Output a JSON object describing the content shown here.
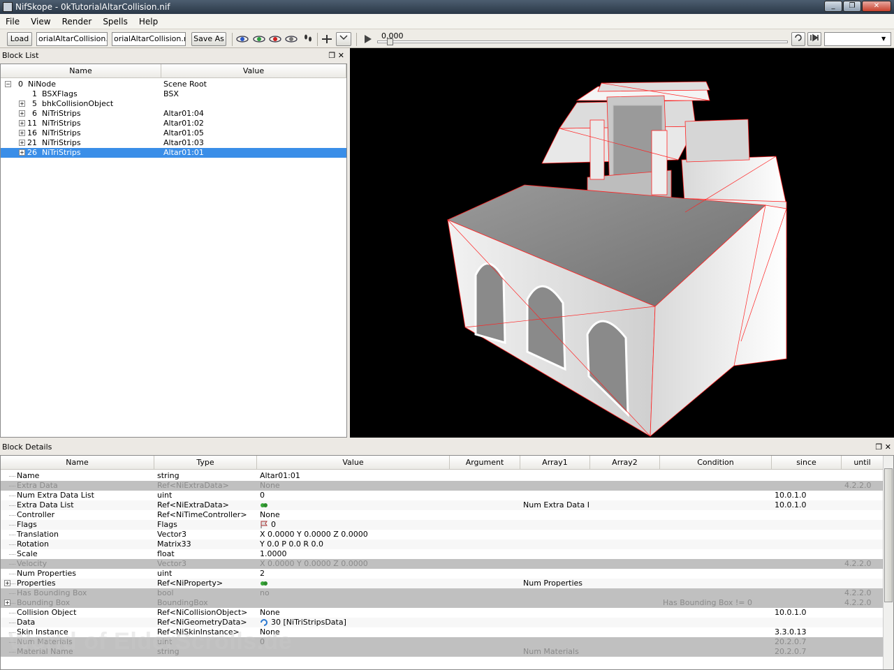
{
  "window": {
    "title": "NifSkope - 0kTutorialAltarCollision.nif",
    "controls": [
      "_",
      "❐",
      "✕"
    ]
  },
  "menu": [
    "File",
    "View",
    "Render",
    "Spells",
    "Help"
  ],
  "toolbar": {
    "load_label": "Load",
    "file_field_1": "orialAltarCollision.nif",
    "file_field_2": "orialAltarCollision.nif",
    "save_as_label": "Save As",
    "time_value": "0.000",
    "animation_select": ""
  },
  "block_list": {
    "panel_title": "Block List",
    "columns": [
      "Name",
      "Value"
    ],
    "rows": [
      {
        "num": "0",
        "name": "NiNode",
        "value": "Scene Root",
        "depth": 0,
        "expander": "−"
      },
      {
        "num": "1",
        "name": "BSXFlags",
        "value": "BSX",
        "depth": 1,
        "expander": ""
      },
      {
        "num": "5",
        "name": "bhkCollisionObject",
        "value": "",
        "depth": 1,
        "expander": "+"
      },
      {
        "num": "6",
        "name": "NiTriStrips",
        "value": "Altar01:04",
        "depth": 1,
        "expander": "+"
      },
      {
        "num": "11",
        "name": "NiTriStrips",
        "value": "Altar01:02",
        "depth": 1,
        "expander": "+"
      },
      {
        "num": "16",
        "name": "NiTriStrips",
        "value": "Altar01:05",
        "depth": 1,
        "expander": "+"
      },
      {
        "num": "21",
        "name": "NiTriStrips",
        "value": "Altar01:03",
        "depth": 1,
        "expander": "+"
      },
      {
        "num": "26",
        "name": "NiTriStrips",
        "value": "Altar01:01",
        "depth": 1,
        "expander": "+",
        "selected": true
      }
    ]
  },
  "block_details": {
    "panel_title": "Block Details",
    "columns": [
      "Name",
      "Type",
      "Value",
      "Argument",
      "Array1",
      "Array2",
      "Condition",
      "since",
      "until"
    ],
    "rows": [
      {
        "name": "Name",
        "type": "string",
        "value": "Altar01:01",
        "argument": "",
        "array1": "",
        "array2": "",
        "condition": "",
        "since": "",
        "until": "",
        "disabled": false
      },
      {
        "name": "Extra Data",
        "type": "Ref<NiExtraData>",
        "value": "None",
        "argument": "",
        "array1": "",
        "array2": "",
        "condition": "",
        "since": "",
        "until": "4.2.2.0",
        "disabled": true
      },
      {
        "name": "Num Extra Data List",
        "type": "uint",
        "value": "0",
        "argument": "",
        "array1": "",
        "array2": "",
        "condition": "",
        "since": "10.0.1.0",
        "until": "",
        "disabled": false
      },
      {
        "name": "Extra Data List",
        "type": "Ref<NiExtraData>",
        "value": "",
        "icon": "link-icon",
        "argument": "",
        "array1": "Num Extra Data L...",
        "array2": "",
        "condition": "",
        "since": "10.0.1.0",
        "until": "",
        "disabled": false
      },
      {
        "name": "Controller",
        "type": "Ref<NiTimeController>",
        "value": "None",
        "argument": "",
        "array1": "",
        "array2": "",
        "condition": "",
        "since": "",
        "until": "",
        "disabled": false
      },
      {
        "name": "Flags",
        "type": "Flags",
        "value": "0",
        "icon": "flag-icon",
        "argument": "",
        "array1": "",
        "array2": "",
        "condition": "",
        "since": "",
        "until": "",
        "disabled": false
      },
      {
        "name": "Translation",
        "type": "Vector3",
        "value": "X 0.0000 Y 0.0000 Z 0.0000",
        "argument": "",
        "array1": "",
        "array2": "",
        "condition": "",
        "since": "",
        "until": "",
        "disabled": false
      },
      {
        "name": "Rotation",
        "type": "Matrix33",
        "value": "Y 0.0 P 0.0 R 0.0",
        "argument": "",
        "array1": "",
        "array2": "",
        "condition": "",
        "since": "",
        "until": "",
        "disabled": false
      },
      {
        "name": "Scale",
        "type": "float",
        "value": "1.0000",
        "argument": "",
        "array1": "",
        "array2": "",
        "condition": "",
        "since": "",
        "until": "",
        "disabled": false
      },
      {
        "name": "Velocity",
        "type": "Vector3",
        "value": "X 0.0000 Y 0.0000 Z 0.0000",
        "argument": "",
        "array1": "",
        "array2": "",
        "condition": "",
        "since": "",
        "until": "4.2.2.0",
        "disabled": true
      },
      {
        "name": "Num Properties",
        "type": "uint",
        "value": "2",
        "argument": "",
        "array1": "",
        "array2": "",
        "condition": "",
        "since": "",
        "until": "",
        "disabled": false
      },
      {
        "name": "Properties",
        "type": "Ref<NiProperty>",
        "value": "",
        "icon": "link-icon",
        "expander": "+",
        "argument": "",
        "array1": "Num Properties",
        "array2": "",
        "condition": "",
        "since": "",
        "until": "",
        "disabled": false
      },
      {
        "name": "Has Bounding Box",
        "type": "bool",
        "value": "no",
        "argument": "",
        "array1": "",
        "array2": "",
        "condition": "",
        "since": "",
        "until": "4.2.2.0",
        "disabled": true
      },
      {
        "name": "Bounding Box",
        "type": "BoundingBox",
        "value": "",
        "expander": "+",
        "argument": "",
        "array1": "",
        "array2": "",
        "condition": "Has Bounding Box != 0",
        "since": "",
        "until": "4.2.2.0",
        "disabled": true
      },
      {
        "name": "Collision Object",
        "type": "Ref<NiCollisionObject>",
        "value": "None",
        "argument": "",
        "array1": "",
        "array2": "",
        "condition": "",
        "since": "10.0.1.0",
        "until": "",
        "disabled": false
      },
      {
        "name": "Data",
        "type": "Ref<NiGeometryData>",
        "value": "30 [NiTriStripsData]",
        "icon": "refresh-icon",
        "argument": "",
        "array1": "",
        "array2": "",
        "condition": "",
        "since": "",
        "until": "",
        "disabled": false
      },
      {
        "name": "Skin Instance",
        "type": "Ref<NiSkinInstance>",
        "value": "None",
        "argument": "",
        "array1": "",
        "array2": "",
        "condition": "",
        "since": "3.3.0.13",
        "until": "",
        "disabled": false
      },
      {
        "name": "Num Materials",
        "type": "uint",
        "value": "0",
        "argument": "",
        "array1": "",
        "array2": "",
        "condition": "",
        "since": "20.2.0.7",
        "until": "",
        "disabled": true
      },
      {
        "name": "Material Name",
        "type": "string",
        "value": "",
        "argument": "",
        "array1": "Num Materials",
        "array2": "",
        "condition": "",
        "since": "20.2.0.7",
        "until": "",
        "disabled": true
      }
    ]
  },
  "watermark": "World of ElderScrolls.de",
  "colors": {
    "selection": "#3a8ee8",
    "viewport_bg": "#000000",
    "wireframe": "#ff2020"
  }
}
